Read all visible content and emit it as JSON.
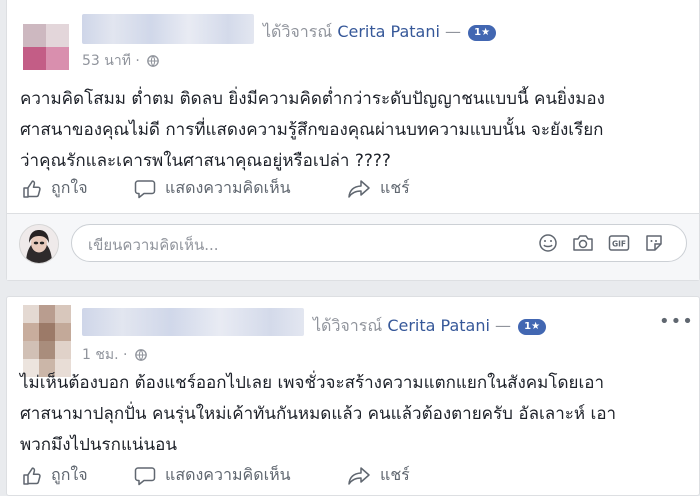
{
  "posts": [
    {
      "commented_text": "ได้วิจารณ์",
      "page_name": "Cerita Patani",
      "dash": "—",
      "badge": "1★",
      "time": "53 นาที",
      "dot": "·",
      "body": "ความคิดโสมม ต่ำตม ติดลบ ยิ่งมีความคิดต่ำกว่าระดับปัญญาชนแบบนี้ คนยิ่งมอง\nศาสนาของคุณไม่ดี การที่แสดงความรู้สึกของคุณผ่านบทความแบบนั้น จะยังเรียก\nว่าคุณรักและเคารพในศาสนาคุณอยู่หรือเปล่า ????",
      "actions": {
        "like": "ถูกใจ",
        "comment": "แสดงความคิดเห็น",
        "share": "แชร์"
      },
      "comment_placeholder": "เขียนความคิดเห็น..."
    },
    {
      "commented_text": "ได้วิจารณ์",
      "page_name": "Cerita Patani",
      "dash": "—",
      "badge": "1★",
      "time": "1 ชม.",
      "dot": "·",
      "body": "ไม่เห็นต้องบอก ต้องแชร์ออกไปเลย เพจชั่วจะสร้างความแตกแยกในสังคมโดยเอา\nศาสนามาปลุกปั่น คนรุ่นใหม่เค้าทันกันหมดแล้ว คนแล้วต้องตายครับ อัลเลาะห์ เอา\nพวกมึงไปนรกแน่นอน",
      "actions": {
        "like": "ถูกใจ",
        "comment": "แสดงความคิดเห็น",
        "share": "แชร์"
      }
    }
  ],
  "colors": {
    "page_link": "#365899",
    "badge_bg": "#4267b2",
    "muted": "#90949c",
    "feed_bg": "#e9ebee"
  },
  "icons": [
    "globe-icon",
    "more-options-icon",
    "like-thumb-icon",
    "comment-bubble-icon",
    "share-arrow-icon",
    "emoji-icon",
    "camera-icon",
    "gif-icon",
    "sticker-icon"
  ]
}
